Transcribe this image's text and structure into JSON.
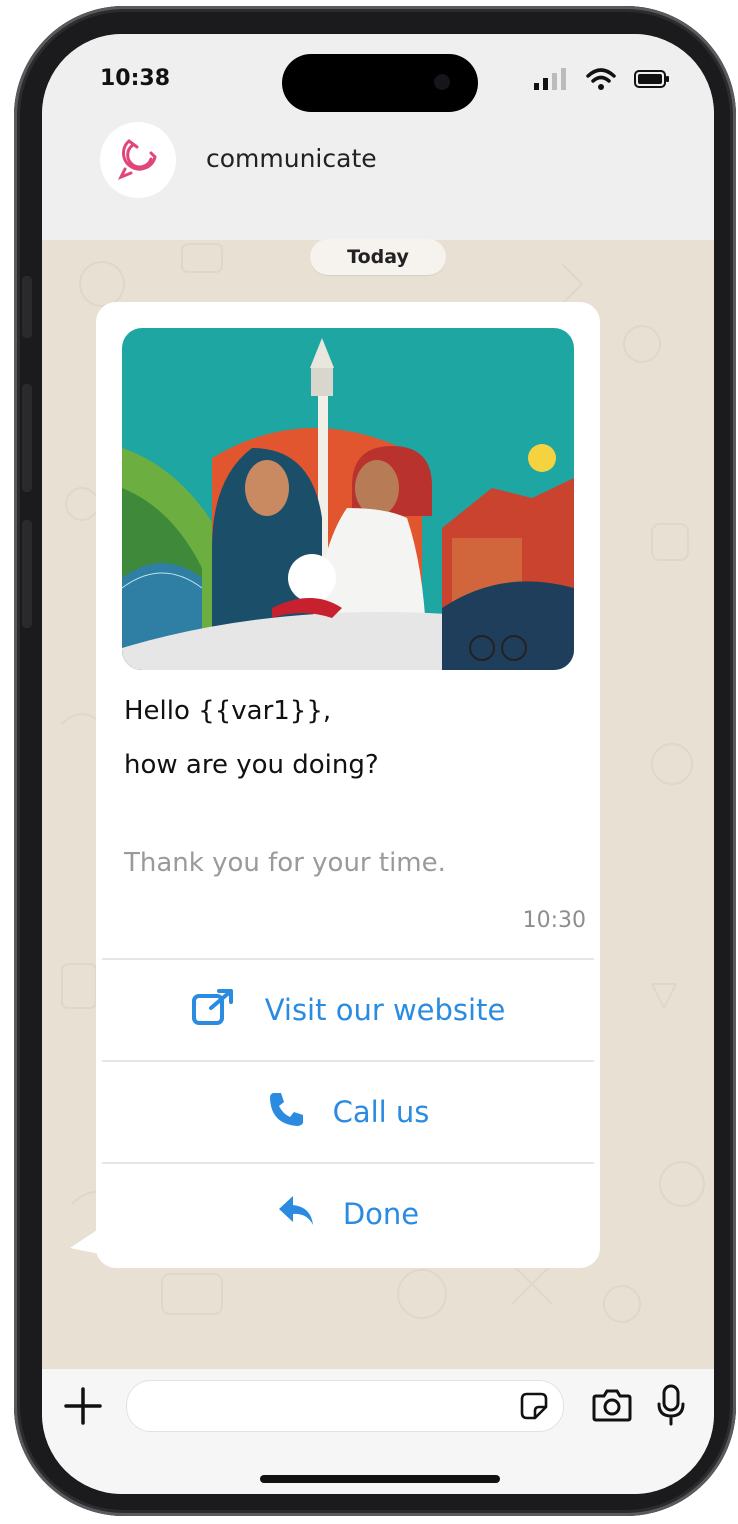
{
  "status_bar": {
    "time": "10:38"
  },
  "chat": {
    "contact_name": "communicate",
    "date_chip": "Today"
  },
  "message": {
    "line1": "Hello  {{var1}},",
    "line2": "how are you doing?",
    "footer": "Thank you for your time.",
    "timestamp": "10:30",
    "buttons": [
      {
        "label": "Visit our website",
        "icon": "external-link-icon"
      },
      {
        "label": "Call us",
        "icon": "phone-icon"
      },
      {
        "label": "Done",
        "icon": "reply-icon"
      }
    ]
  },
  "colors": {
    "accent": "#2a8be0",
    "brand": "#e0457b",
    "wallpaper": "#e8e1d3"
  }
}
